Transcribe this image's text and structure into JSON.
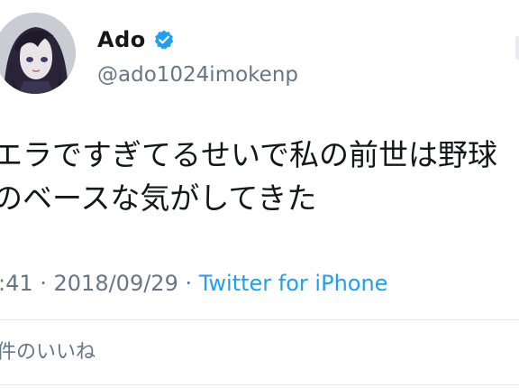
{
  "user": {
    "display_name": "Ado",
    "handle": "@ado1024imokenp",
    "verified_icon": "verified-badge-icon",
    "avatar_icon": "anime-character-avatar"
  },
  "tweet": {
    "lines": [
      "エラですぎてるせいで私の前世は野球",
      "のベースな気がしてきた"
    ]
  },
  "meta": {
    "time": ":41",
    "separator1": " · ",
    "date": "2018/09/29",
    "separator2": " · ",
    "source": "Twitter for iPhone"
  },
  "likes": {
    "label": "件のいいね"
  },
  "colors": {
    "text": "#14171a",
    "secondary": "#657786",
    "link": "#1da1f2",
    "verified": "#1da1f2"
  }
}
